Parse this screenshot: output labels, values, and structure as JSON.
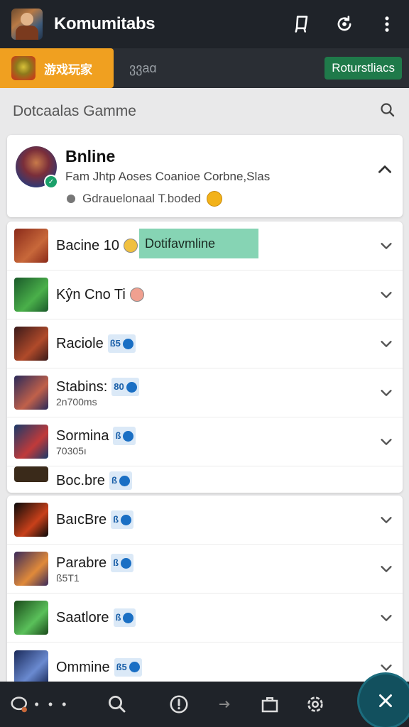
{
  "header": {
    "app_title": "Komumitabs",
    "icons": [
      "device-icon",
      "refresh-icon",
      "more-vertical-icon"
    ]
  },
  "tabs": {
    "active_label": "游戏玩家",
    "second_label": "ვვaɑ",
    "pill_label": "Roturstliacs"
  },
  "section": {
    "title": "Dotcaalas Gamme",
    "search_icon": "search-icon"
  },
  "featured": {
    "title": "Bnline",
    "subtitle": "Fam Jhtp Aoses Coanioe Corbne,Slas",
    "status": "Gdrauelonaal T.boded",
    "badge_icon": "check-icon"
  },
  "list_a": [
    {
      "title": "Bacine 10",
      "sub": "",
      "badge": "",
      "emoji_color": "#f0c040",
      "chip": "Dotifavmline",
      "icon_colors": [
        "#8a2a1a",
        "#c8683a"
      ]
    },
    {
      "title": "Kŷn Cno Ti",
      "sub": "",
      "badge": "",
      "emoji_color": "#f0a090",
      "chip": "",
      "icon_colors": [
        "#1a5a2a",
        "#4ab04a"
      ]
    },
    {
      "title": "Raciole",
      "sub": "",
      "badge": "ß5",
      "emoji_color": "",
      "chip": "",
      "icon_colors": [
        "#3a1a1a",
        "#b04a2a"
      ]
    },
    {
      "title": "Stabins:",
      "sub": "2n700ms",
      "badge": "80",
      "emoji_color": "",
      "chip": "",
      "icon_colors": [
        "#2a2a5a",
        "#c0604a"
      ]
    },
    {
      "title": "Sormina",
      "sub": "70305ı",
      "badge": "ß",
      "emoji_color": "",
      "chip": "",
      "icon_colors": [
        "#1a3a6a",
        "#c03a3a"
      ]
    }
  ],
  "partial_row": {
    "title": "Boc.bre",
    "badge": "ß"
  },
  "list_b": [
    {
      "title": "BaıcBre",
      "sub": "",
      "badge": "ß",
      "icon_colors": [
        "#0a0a0a",
        "#c8401a"
      ]
    },
    {
      "title": "Parabre",
      "sub": "ß5T1",
      "badge": "ß",
      "icon_colors": [
        "#3a2a5a",
        "#e08a3a"
      ]
    },
    {
      "title": "Saatlore",
      "sub": "",
      "badge": "ß",
      "icon_colors": [
        "#1a4a1a",
        "#5ac05a"
      ]
    },
    {
      "title": "Ommine",
      "sub": "",
      "badge": "ß5",
      "icon_colors": [
        "#1a2a5a",
        "#6a8ad0"
      ]
    }
  ],
  "bottom_nav": {
    "dots": "• • •",
    "icons": [
      "chat-icon",
      "search-icon",
      "alert-icon",
      "arrow-icon",
      "folder-icon",
      "settings-icon"
    ],
    "fab_icon": "close-icon"
  },
  "colors": {
    "topbar": "#1f2329",
    "tab_active": "#f0a020",
    "pill": "#1f7a4a",
    "chip": "#86d4b4",
    "fab": "#12505e"
  }
}
